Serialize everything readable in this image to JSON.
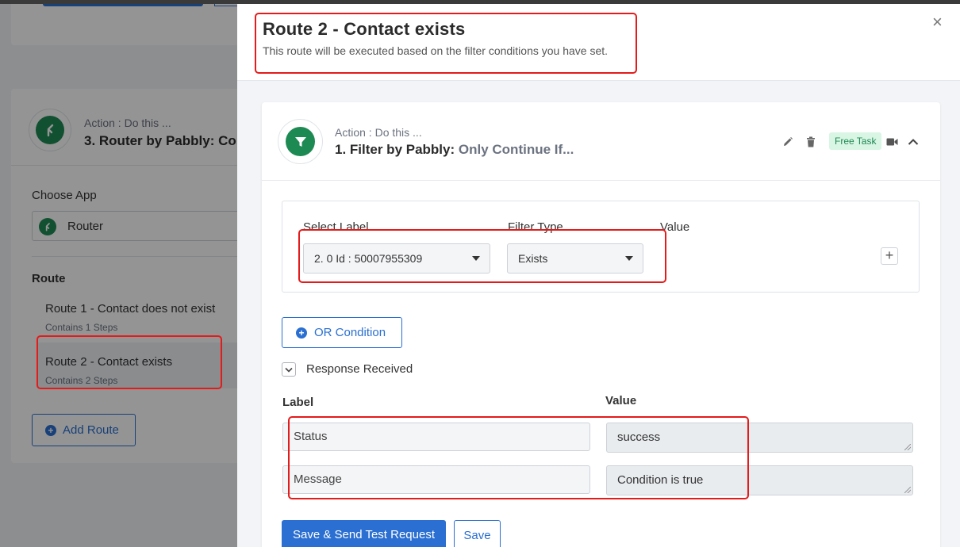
{
  "background": {
    "card": {
      "action_text": "Action : Do this ...",
      "title": "3. Router by Pabbly: Co",
      "choose_app_label": "Choose App",
      "app_name": "Router",
      "route_heading": "Route",
      "routes": [
        {
          "name": "Route 1 - Contact does not exist",
          "steps": "Contains 1 Steps"
        },
        {
          "name": "Route 2 - Contact exists",
          "steps": "Contains 2 Steps"
        }
      ],
      "add_route_label": "Add Route"
    }
  },
  "drawer": {
    "title": "Route 2 - Contact exists",
    "subtitle": "This route will be executed based on the filter conditions you have set.",
    "close_symbol": "×",
    "step": {
      "action_text": "Action : Do this ...",
      "title_app": "1. Filter by Pabbly:",
      "title_event": "Only Continue If...",
      "badge": "Free Task",
      "icons": [
        "pencil-icon",
        "trash-icon",
        "video-icon",
        "chevron-up-icon"
      ]
    },
    "filter": {
      "select_label_heading": "Select Label",
      "filter_type_heading": "Filter Type",
      "value_heading": "Value",
      "selected_label": "2. 0 Id : 50007955309",
      "selected_filter_type": "Exists",
      "add_symbol": "+"
    },
    "or_condition_label": "OR Condition",
    "response": {
      "toggle_label": "Response Received",
      "label_heading": "Label",
      "value_heading": "Value",
      "rows": [
        {
          "label": "Status",
          "value": "success"
        },
        {
          "label": "Message",
          "value": "Condition is true"
        }
      ]
    },
    "buttons": {
      "save_and_test": "Save & Send Test Request",
      "save": "Save"
    }
  },
  "colors": {
    "accent": "#2a6fd1",
    "brand_green": "#1e8a53",
    "highlight_red": "#e41b1b",
    "badge_bg": "#d9f5e4"
  }
}
